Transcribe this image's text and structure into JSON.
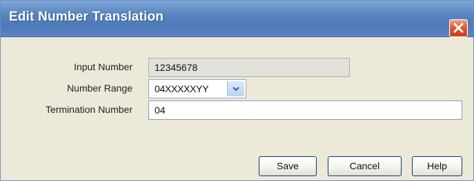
{
  "dialog": {
    "title": "Edit Number Translation"
  },
  "form": {
    "input_number_label": "Input Number",
    "input_number_value": "12345678",
    "number_range_label": "Number Range",
    "number_range_value": "04XXXXXYY",
    "termination_number_label": "Termination Number",
    "termination_number_value": "04"
  },
  "buttons": {
    "save": "Save",
    "cancel": "Cancel",
    "help": "Help"
  },
  "icons": {
    "close": "close-icon",
    "dropdown": "chevron-down-icon"
  },
  "colors": {
    "title_bar": "#5a86c2",
    "dialog_background": "#ece9d8",
    "close_button": "#df5a2e",
    "field_border": "#7f9db9"
  }
}
